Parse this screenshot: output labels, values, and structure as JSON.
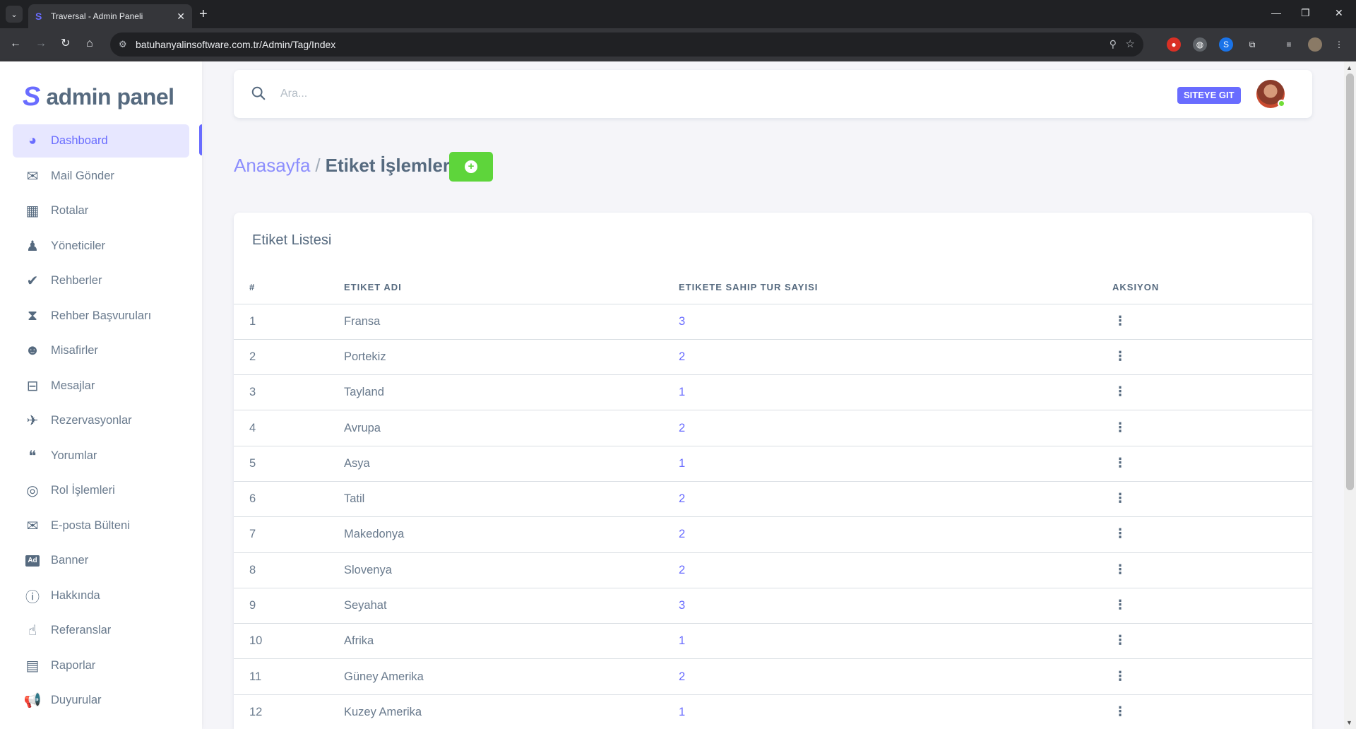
{
  "browser": {
    "tab_title": "Traversal - Admin Paneli",
    "url": "batuhanyalinsoftware.com.tr/Admin/Tag/Index"
  },
  "brand": {
    "name": "admin panel"
  },
  "sidebar": {
    "items": [
      {
        "label": "Dashboard",
        "icon": "palette-icon"
      },
      {
        "label": "Mail Gönder",
        "icon": "mail-open-icon"
      },
      {
        "label": "Rotalar",
        "icon": "map-icon"
      },
      {
        "label": "Yöneticiler",
        "icon": "user-tie-icon"
      },
      {
        "label": "Rehberler",
        "icon": "user-check-icon"
      },
      {
        "label": "Rehber Başvuruları",
        "icon": "hourglass-icon"
      },
      {
        "label": "Misafirler",
        "icon": "users-icon"
      },
      {
        "label": "Mesajlar",
        "icon": "inbox-icon"
      },
      {
        "label": "Rezervasyonlar",
        "icon": "plane-departure-icon"
      },
      {
        "label": "Yorumlar",
        "icon": "comments-icon"
      },
      {
        "label": "Rol İşlemleri",
        "icon": "fingerprint-icon"
      },
      {
        "label": "E-posta Bülteni",
        "icon": "envelope-icon"
      },
      {
        "label": "Banner",
        "icon": "ad-icon"
      },
      {
        "label": "Hakkında",
        "icon": "info-circle-icon"
      },
      {
        "label": "Referanslar",
        "icon": "thumbs-up-icon"
      },
      {
        "label": "Raporlar",
        "icon": "pdf-file-icon"
      },
      {
        "label": "Duyurular",
        "icon": "bullhorn-icon"
      }
    ]
  },
  "topbar": {
    "search_placeholder": "Ara...",
    "site_button": "SITEYE GIT"
  },
  "breadcrumb": {
    "home": "Anasayfa",
    "separator": "/",
    "current": "Etiket İşlemleri"
  },
  "add_button": {
    "symbol": "+"
  },
  "table": {
    "title": "Etiket Listesi",
    "headers": [
      "#",
      "ETIKET ADI",
      "ETIKETE SAHIP TUR SAYISI",
      "AKSIYON"
    ],
    "action_symbol": "⋮",
    "rows": [
      {
        "id": "1",
        "name": "Fransa",
        "count": "3"
      },
      {
        "id": "2",
        "name": "Portekiz",
        "count": "2"
      },
      {
        "id": "3",
        "name": "Tayland",
        "count": "1"
      },
      {
        "id": "4",
        "name": "Avrupa",
        "count": "2"
      },
      {
        "id": "5",
        "name": "Asya",
        "count": "1"
      },
      {
        "id": "6",
        "name": "Tatil",
        "count": "2"
      },
      {
        "id": "7",
        "name": "Makedonya",
        "count": "2"
      },
      {
        "id": "8",
        "name": "Slovenya",
        "count": "2"
      },
      {
        "id": "9",
        "name": "Seyahat",
        "count": "3"
      },
      {
        "id": "10",
        "name": "Afrika",
        "count": "1"
      },
      {
        "id": "11",
        "name": "Güney Amerika",
        "count": "2"
      },
      {
        "id": "12",
        "name": "Kuzey Amerika",
        "count": "1"
      }
    ]
  },
  "colors": {
    "accent": "#696cff",
    "add_button": "#5ed53b",
    "online": "#71dd37"
  }
}
